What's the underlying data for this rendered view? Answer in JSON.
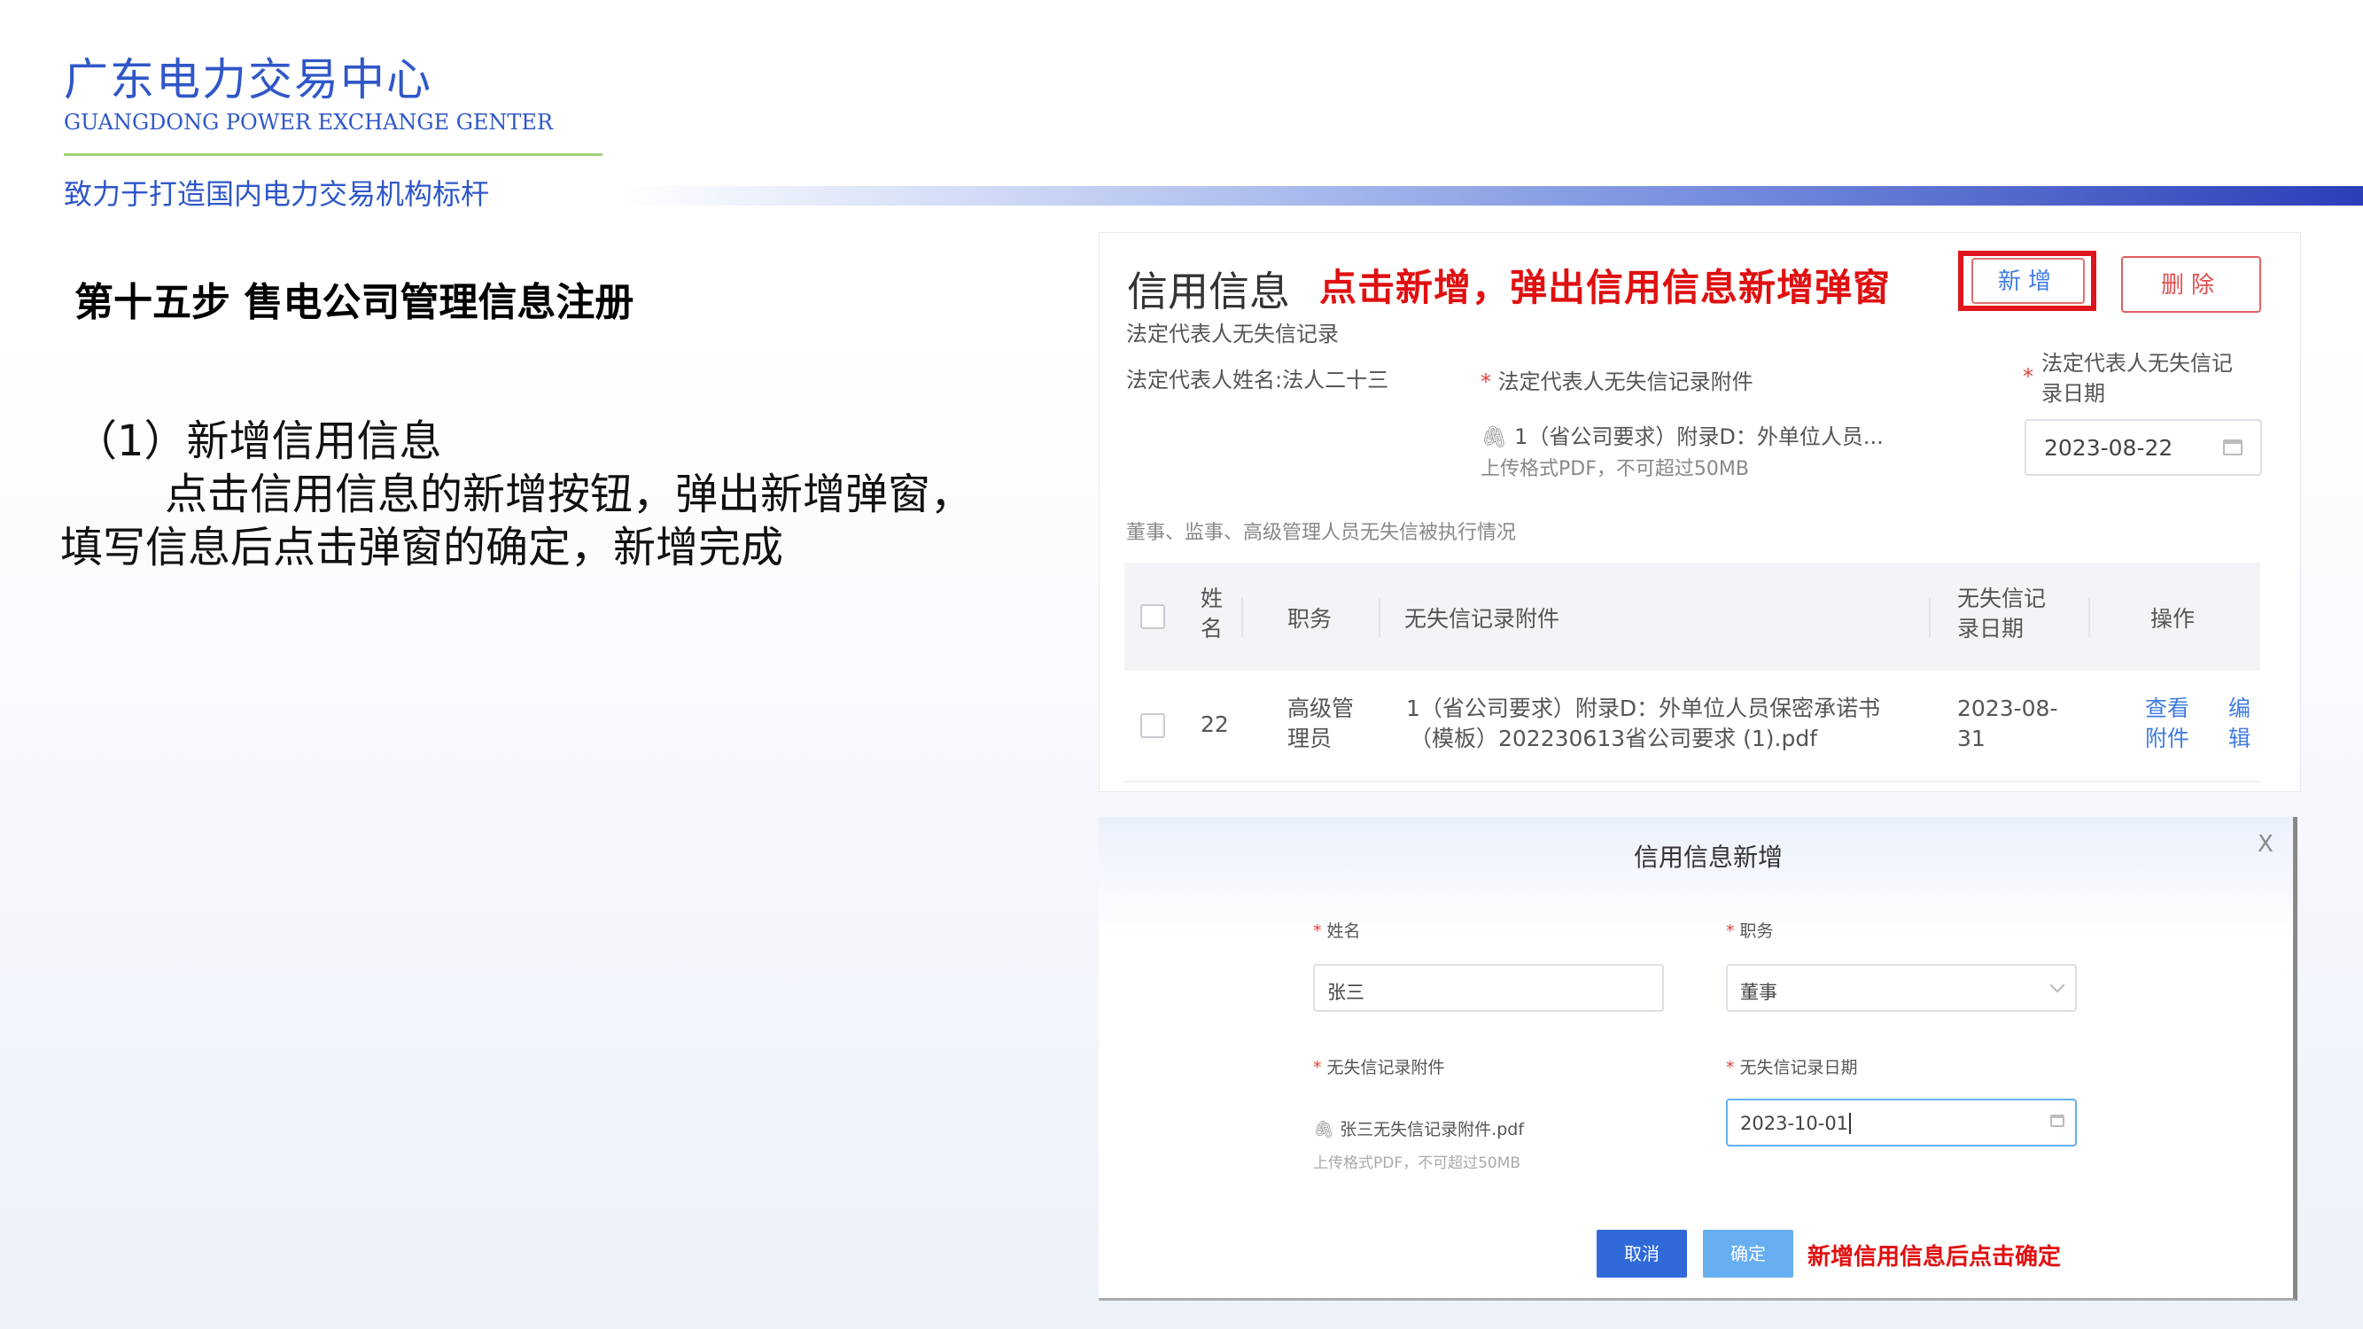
{
  "header": {
    "org_name": "广东电力交易中心",
    "org_name_en": "GUANGDONG POWER EXCHANGE GENTER",
    "slogan": "致力于打造国内电力交易机构标杆"
  },
  "left": {
    "step_title": "第十五步 售电公司管理信息注册",
    "sub_heading": "（1）新增信用信息",
    "desc_line1": "点击信用信息的新增按钮，弹出新增弹窗，",
    "desc_line2": "填写信息后点击弹窗的确定，新增完成"
  },
  "credit_panel": {
    "title": "信用信息",
    "hint": "点击新增，弹出信用信息新增弹窗",
    "add_button": "新增",
    "delete_button": "删除",
    "section1": "法定代表人无失信记录",
    "legal_rep_name_label": "法定代表人姓名:",
    "legal_rep_name_value": "法人二十三",
    "attachment_label": "法定代表人无失信记录附件",
    "attachment_file": "1（省公司要求）附录D：外单位人员...",
    "upload_hint": "上传格式PDF，不可超过50MB",
    "date_label_line1": "法定代表人无失信记",
    "date_label_line2": "录日期",
    "date_value": "2023-08-22",
    "section2": "董事、监事、高级管理人员无失信被执行情况",
    "table": {
      "headers": [
        "姓名",
        "职务",
        "无失信记录附件",
        "无失信记录日期",
        "操作"
      ],
      "header_name_lines": [
        "姓",
        "名"
      ],
      "header_date_lines": [
        "无失信记",
        "录日期"
      ],
      "rows": [
        {
          "name": "22",
          "position_lines": [
            "高级管",
            "理员"
          ],
          "attachment_lines": [
            "1（省公司要求）附录D：外单位人员保密承诺书",
            "（模板）202230613省公司要求 (1).pdf"
          ],
          "date_lines": [
            "2023-08-",
            "31"
          ],
          "action_view_lines": [
            "查看",
            "附件"
          ],
          "action_edit_lines": [
            "编",
            "辑"
          ]
        }
      ]
    }
  },
  "dialog": {
    "title": "信用信息新增",
    "close": "X",
    "name_label": "姓名",
    "name_value": "张三",
    "position_label": "职务",
    "position_value": "董事",
    "attachment_label": "无失信记录附件",
    "attachment_file": "张三无失信记录附件.pdf",
    "upload_hint": "上传格式PDF，不可超过50MB",
    "date_label": "无失信记录日期",
    "date_value": "2023-10-01",
    "cancel": "取消",
    "confirm": "确定",
    "hint": "新增信用信息后点击确定"
  },
  "colors": {
    "brand_blue": "#2f57c8",
    "highlight_red": "#e01010",
    "link_blue": "#3f7ce0",
    "primary_button": "#2f6ad8",
    "confirm_button": "#66aef0"
  }
}
